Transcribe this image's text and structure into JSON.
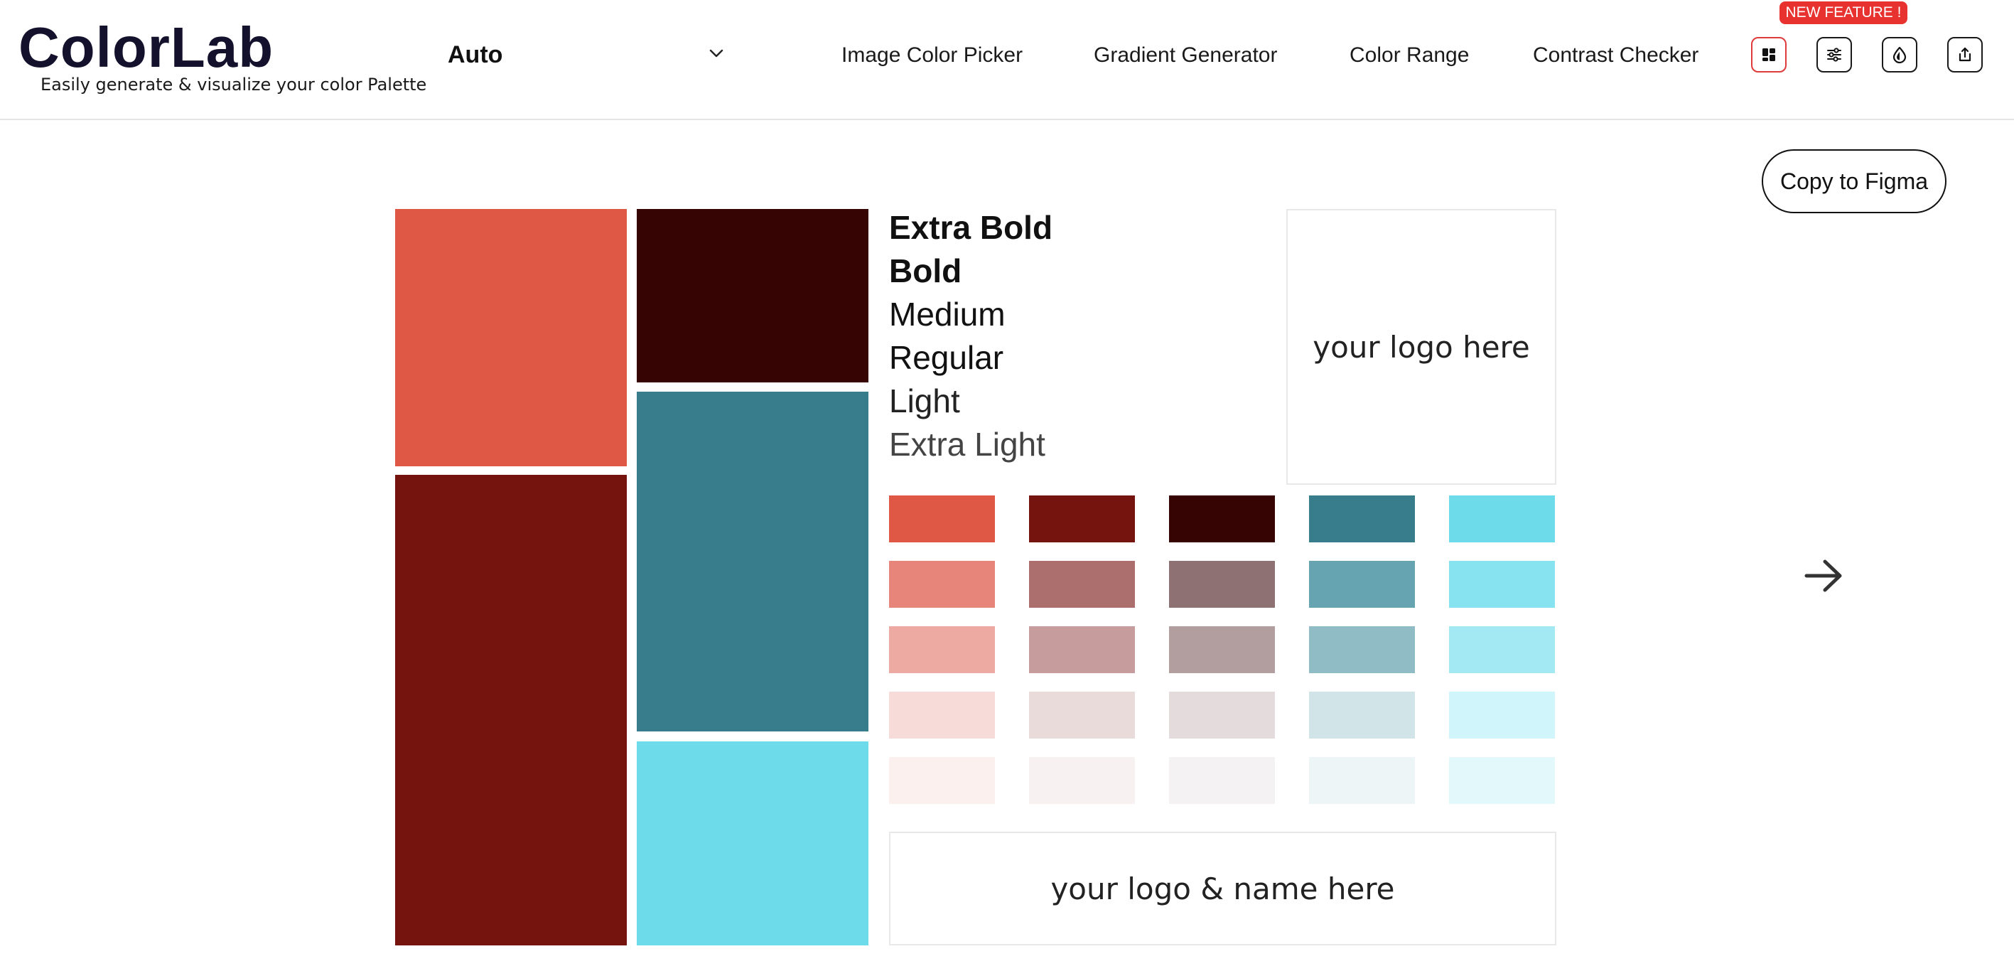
{
  "brand": {
    "title": "ColorLab",
    "tagline": "Easily generate & visualize your color Palette"
  },
  "mode_select": {
    "value": "Auto"
  },
  "nav": {
    "links": [
      "Image Color Picker",
      "Gradient Generator",
      "Color Range",
      "Contrast Checker"
    ]
  },
  "toolbar": {
    "badge": "NEW FEATURE !",
    "icons": [
      "layout-grid-icon",
      "sliders-icon",
      "droplet-icon",
      "share-icon"
    ]
  },
  "actions": {
    "copy_figma": "Copy to Figma"
  },
  "palette": {
    "colors": [
      "#df5745",
      "#75130f",
      "#370404",
      "#387d8c",
      "#6ddbea"
    ]
  },
  "font_samples": [
    "Extra Bold",
    "Bold",
    "Medium",
    "Regular",
    "Light",
    "Extra Light"
  ],
  "logo_placeholders": {
    "square": "your logo here",
    "wide": "your logo & name here"
  },
  "shades": [
    [
      "#df5745",
      "#75130f",
      "#370404",
      "#387d8c",
      "#6ddbea"
    ],
    [
      "#e7857a",
      "#ac6f6d",
      "#8e7172",
      "#65a4b0",
      "#86e3ef"
    ],
    [
      "#ecaaa3",
      "#c69d9c",
      "#b39e9f",
      "#8fbcc5",
      "#a3e9f3"
    ],
    [
      "#f7dbd8",
      "#e9dbda",
      "#e4dbdc",
      "#d1e5e8",
      "#d0f5fa"
    ],
    [
      "#fcf0ee",
      "#f7f1f1",
      "#f4f2f2",
      "#edf5f6",
      "#e3f8fb"
    ]
  ]
}
